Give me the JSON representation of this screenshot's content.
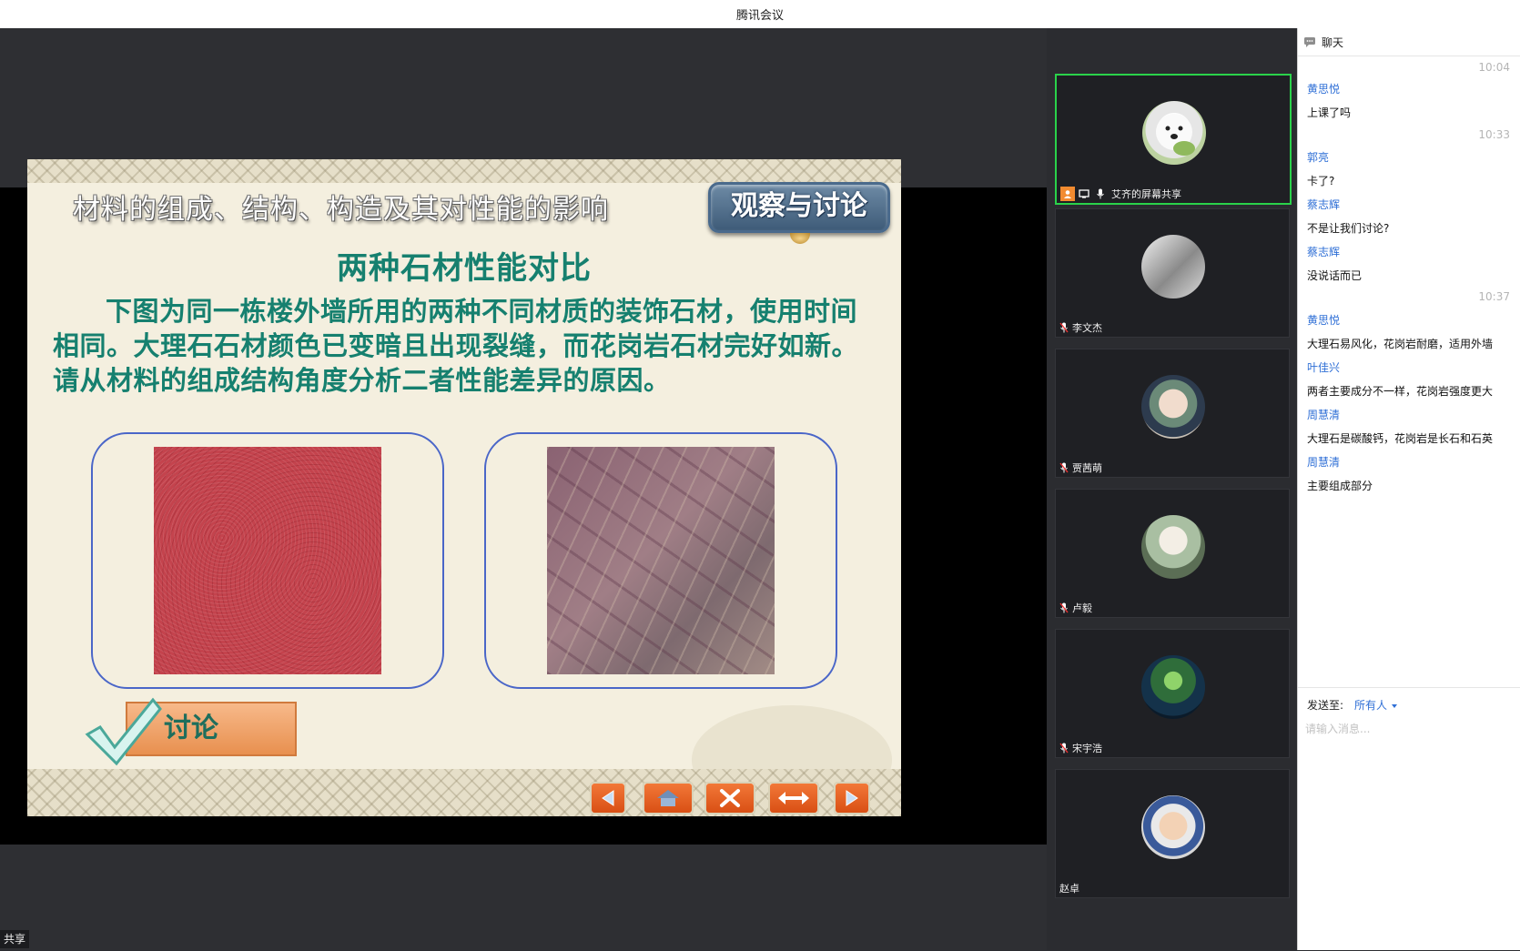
{
  "window": {
    "title": "腾讯会议"
  },
  "share": {
    "badge": "共享"
  },
  "slide": {
    "heading": "材料的组成、结构、构造及其对性能的影响",
    "badge": "观察与讨论",
    "title": "两种石材性能对比",
    "paragraph": "下图为同一栋楼外墙所用的两种不同材质的装饰石材，使用时间相同。大理石石材颜色已变暗且出现裂缝，而花岗岩石材完好如新。请从材料的组成结构角度分析二者性能差异的原因。",
    "discuss_label": "讨论",
    "nav_icons": [
      "prev-arrow-icon",
      "home-icon",
      "close-icon",
      "swap-arrows-icon",
      "next-arrow-icon"
    ]
  },
  "participants": [
    {
      "name": "艾齐的屏幕共享",
      "avatar": "white-dog",
      "active": true
    },
    {
      "name": "李文杰",
      "avatar": "anime-sketch",
      "active": false
    },
    {
      "name": "贾茜萌",
      "avatar": "anime-girl",
      "active": false
    },
    {
      "name": "卢毅",
      "avatar": "anime-white-hair",
      "active": false
    },
    {
      "name": "宋宇浩",
      "avatar": "green-landscape",
      "active": false
    },
    {
      "name": "赵卓",
      "avatar": "child-photo",
      "active": false
    }
  ],
  "chat": {
    "title": "聊天",
    "times": [
      "10:04",
      "10:33",
      "10:37"
    ],
    "messages": [
      {
        "sender": "黄思悦",
        "text": "上课了吗"
      },
      {
        "sender": "郭亮",
        "text": "卡了?"
      },
      {
        "sender": "蔡志辉",
        "text": "不是让我们讨论?"
      },
      {
        "sender": "蔡志辉",
        "text": "没说话而已"
      },
      {
        "sender": "黄思悦",
        "text": "大理石易风化，花岗岩耐磨，适用外墙"
      },
      {
        "sender": "叶佳兴",
        "text": "两者主要成分不一样，花岗岩强度更大"
      },
      {
        "sender": "周慧清",
        "text": "大理石是碳酸钙，花岗岩是长石和石英"
      },
      {
        "sender": "周慧清",
        "text": "主要组成部分"
      }
    ],
    "send_to_label": "发送至:",
    "send_to_value": "所有人",
    "input_placeholder": "请输入消息..."
  }
}
